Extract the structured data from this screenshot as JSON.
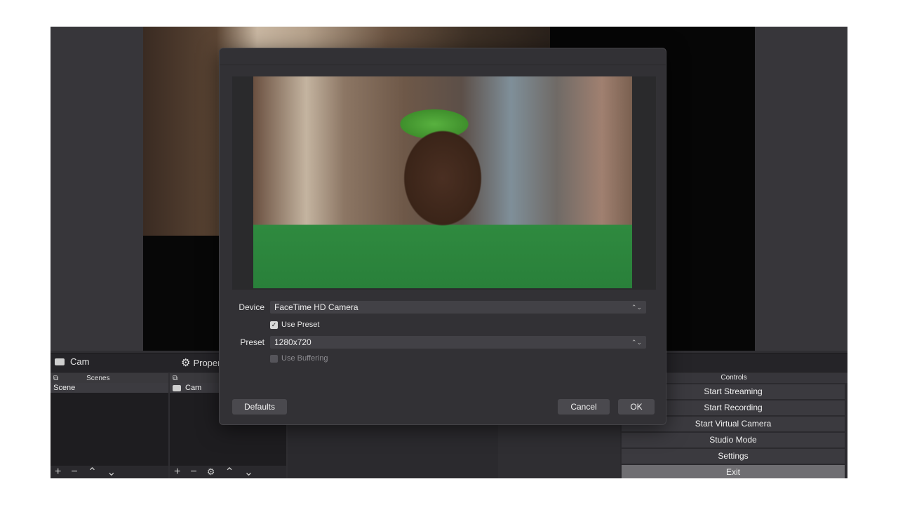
{
  "main": {
    "sources_panel_title": "Cam",
    "properties_panel_title": "Proper",
    "scenes_header": "Scenes",
    "scenes": [
      "Scene"
    ],
    "sources": [
      "Cam"
    ],
    "controls": {
      "header": "Controls",
      "buttons": [
        "Start Streaming",
        "Start Recording",
        "Start Virtual Camera",
        "Studio Mode",
        "Settings",
        "Exit"
      ]
    },
    "toolbar_symbols": {
      "add": "+",
      "remove": "−",
      "up": "⌃",
      "down": "⌄"
    }
  },
  "dialog": {
    "device_label": "Device",
    "device_value": "FaceTime HD Camera",
    "use_preset_label": "Use Preset",
    "use_preset_checked": true,
    "preset_label": "Preset",
    "preset_value": "1280x720",
    "use_buffering_label": "Use Buffering",
    "use_buffering_checked": false,
    "defaults_button": "Defaults",
    "cancel_button": "Cancel",
    "ok_button": "OK"
  },
  "colors": {
    "dialog_bg": "#323135",
    "panel_bg": "#1e1d20",
    "button_bg": "#3b3a3f",
    "accent_green": "#58b13f"
  }
}
